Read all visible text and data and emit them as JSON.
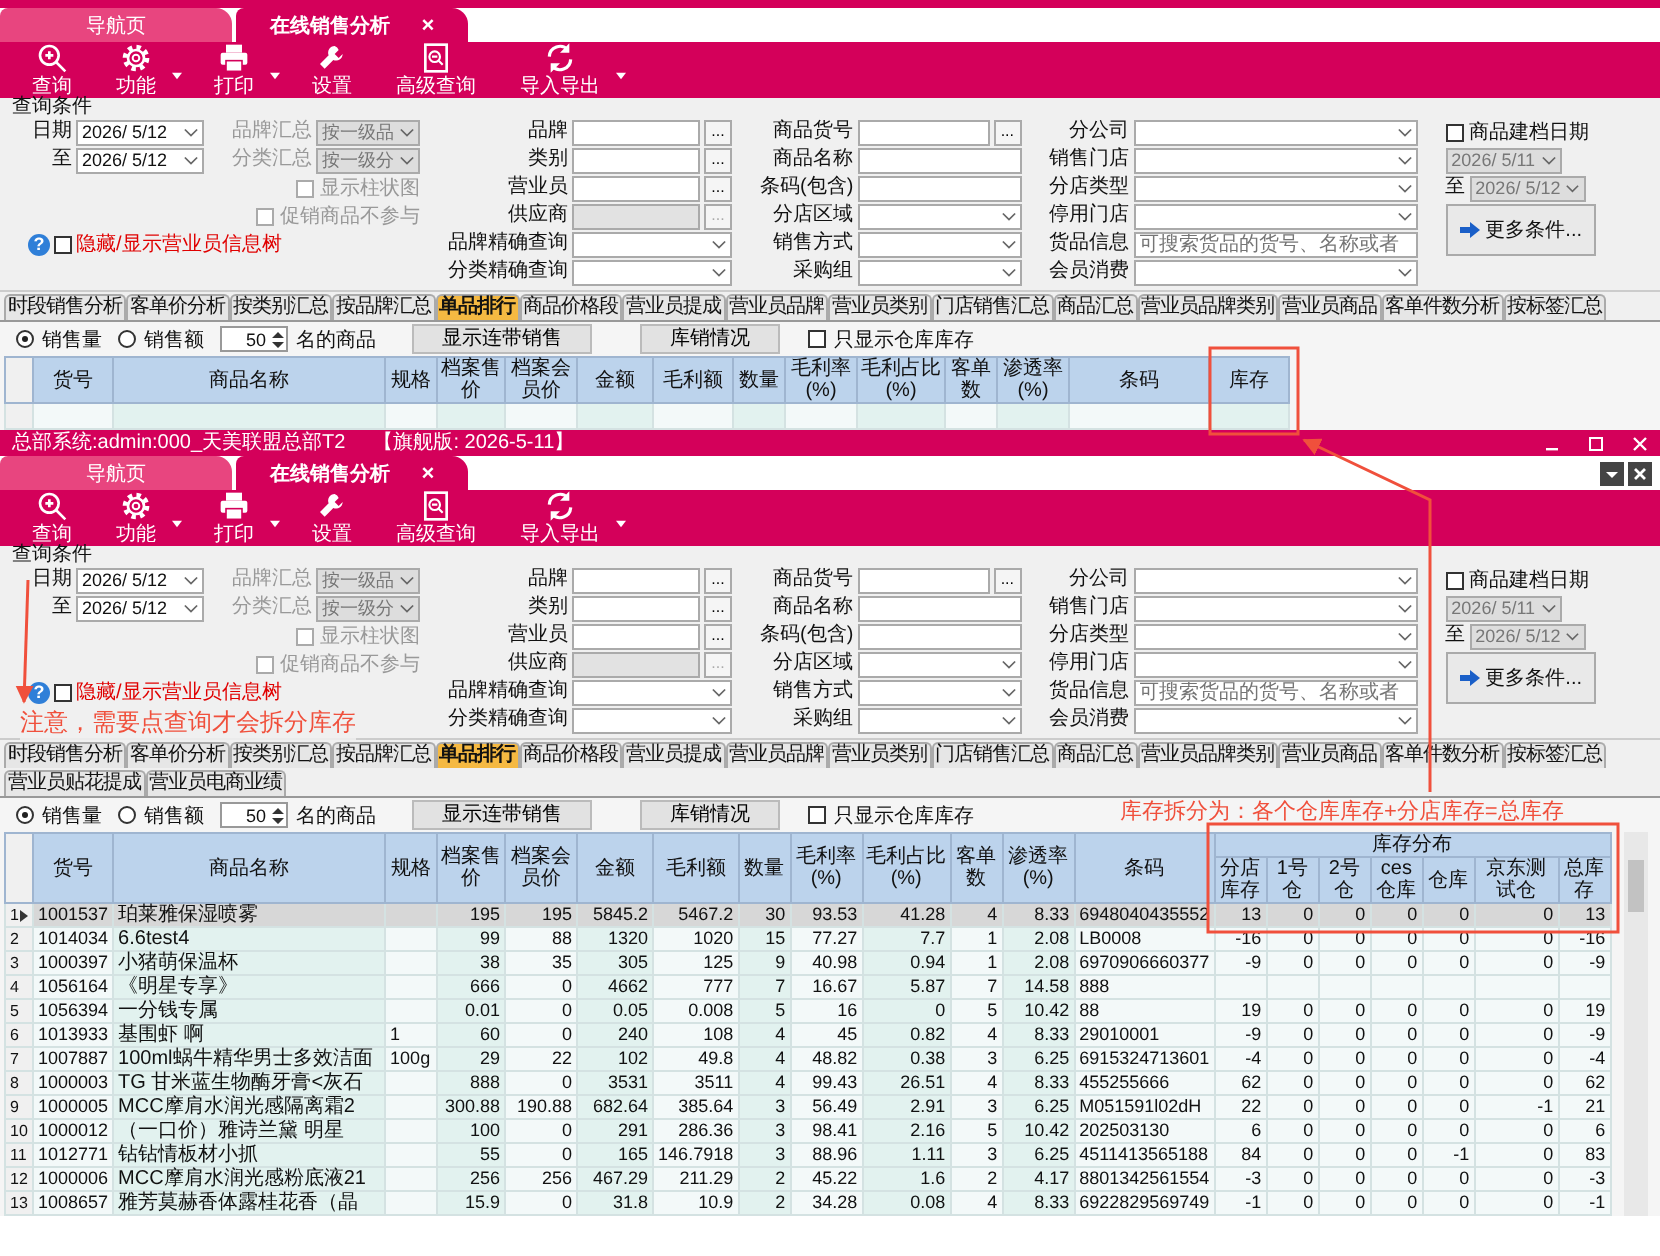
{
  "windows": [
    {
      "doc_tabs": [
        {
          "label": "导航页",
          "selected": false
        },
        {
          "label": "在线销售分析",
          "selected": true,
          "close": "×"
        }
      ],
      "toolbar": [
        {
          "label": "查询",
          "kind": "search",
          "dropdown": false
        },
        {
          "label": "功能",
          "kind": "gear",
          "dropdown": true
        },
        {
          "label": "打印",
          "kind": "printer",
          "dropdown": true
        },
        {
          "label": "设置",
          "kind": "wrench",
          "dropdown": false
        },
        {
          "label": "高级查询",
          "kind": "report",
          "dropdown": false
        },
        {
          "label": "导入导出",
          "kind": "sync",
          "dropdown": true
        }
      ],
      "query": {
        "title": "查询条件",
        "columns": [
          [
            {
              "kind": "date",
              "label": "日期",
              "value": "2026/ 5/12",
              "disabled": false
            },
            {
              "kind": "date",
              "label": "至",
              "value": "2026/ 5/12",
              "disabled": false
            },
            {
              "kind": "toggle",
              "help": "?",
              "label": "隐藏/显示营业员信息树",
              "checked": false,
              "disabled": false
            }
          ],
          [
            {
              "kind": "combo",
              "label": "品牌汇总",
              "value": "按一级品",
              "disabled": true
            },
            {
              "kind": "combo",
              "label": "分类汇总",
              "value": "按一级分",
              "disabled": true
            },
            {
              "kind": "check",
              "label": "显示柱状图",
              "checked": false,
              "disabled": true
            },
            {
              "kind": "check",
              "label": "促销商品不参与",
              "checked": false,
              "disabled": true
            }
          ],
          [
            {
              "kind": "lookup",
              "label": "品牌",
              "button": "...",
              "disabled": false
            },
            {
              "kind": "lookup",
              "label": "类别",
              "button": "...",
              "disabled": false
            },
            {
              "kind": "lookup",
              "label": "营业员",
              "button": "...",
              "disabled": false
            },
            {
              "kind": "lookup",
              "label": "供应商",
              "button": "...",
              "disabled": true
            },
            {
              "kind": "combo",
              "label": "品牌精确查询",
              "disabled": false
            },
            {
              "kind": "combo",
              "label": "分类精确查询",
              "disabled": false
            }
          ],
          [
            {
              "kind": "lookup",
              "label": "商品货号",
              "button": "...",
              "disabled": false
            },
            {
              "kind": "text",
              "label": "商品名称",
              "disabled": false
            },
            {
              "kind": "text",
              "label": "条码(包含)",
              "disabled": false
            },
            {
              "kind": "combo",
              "label": "分店区域",
              "disabled": false
            },
            {
              "kind": "combo",
              "label": "销售方式",
              "disabled": false
            },
            {
              "kind": "combo",
              "label": "采购组",
              "disabled": false
            }
          ],
          [
            {
              "kind": "combo",
              "label": "分公司",
              "disabled": false
            },
            {
              "kind": "combo",
              "label": "销售门店",
              "disabled": false
            },
            {
              "kind": "combo",
              "label": "分店类型",
              "disabled": false
            },
            {
              "kind": "combo",
              "label": "停用门店",
              "disabled": false
            },
            {
              "kind": "text",
              "label": "货品信息",
              "placeholder": "可搜索货品的货号、名称或者",
              "disabled": false
            },
            {
              "kind": "combo",
              "label": "会员消费",
              "disabled": false
            }
          ],
          [
            {
              "kind": "check",
              "label": "商品建档日期",
              "checked": false,
              "disabled": false
            },
            {
              "kind": "date",
              "value": "2026/ 5/11",
              "disabled": true
            },
            {
              "kind": "date",
              "label": "至",
              "value": "2026/ 5/12",
              "disabled": true
            },
            {
              "kind": "button",
              "label": "更多条件...",
              "disabled": false
            }
          ]
        ]
      },
      "report_tabs": [
        {
          "label": "时段销售分析",
          "selected": false
        },
        {
          "label": "客单价分析",
          "selected": false
        },
        {
          "label": "按类别汇总",
          "selected": false
        },
        {
          "label": "按品牌汇总",
          "selected": false
        },
        {
          "label": "单品排行",
          "selected": true
        },
        {
          "label": "商品价格段",
          "selected": false
        },
        {
          "label": "营业员提成",
          "selected": false
        },
        {
          "label": "营业员品牌",
          "selected": false
        },
        {
          "label": "营业员类别",
          "selected": false
        },
        {
          "label": "门店销售汇总",
          "selected": false
        },
        {
          "label": "商品汇总",
          "selected": false
        },
        {
          "label": "营业员品牌类别",
          "selected": false
        },
        {
          "label": "营业员商品",
          "selected": false
        },
        {
          "label": "客单件数分析",
          "selected": false
        },
        {
          "label": "按标签汇总",
          "selected": false
        }
      ],
      "options": {
        "sort": [
          {
            "label": "销售量",
            "selected": true
          },
          {
            "label": "销售额",
            "selected": false
          }
        ],
        "top_n": "50",
        "suffix": "名的商品",
        "buttons": [
          "显示连带销售",
          "库销情况"
        ],
        "only_warehouse": {
          "label": "只显示仓库库存",
          "checked": false
        }
      },
      "table": {
        "columns": [
          "货号",
          "商品名称",
          "规格",
          "档案售价",
          "档案会员价",
          "金额",
          "毛利额",
          "数量",
          "毛利率(%)",
          "毛利占比(%)",
          "客单数",
          "渗透率(%)",
          "条码",
          "库存"
        ]
      }
    },
    {
      "title_bar": {
        "title": "总部系统:admin:000_天美联盟总部T2",
        "edition": "【旗舰版: 2026-5-11】"
      },
      "strip_buttons": true,
      "doc_tabs": [
        {
          "label": "导航页",
          "selected": false
        },
        {
          "label": "在线销售分析",
          "selected": true,
          "close": "×"
        }
      ],
      "toolbar": [
        {
          "label": "查询",
          "kind": "search",
          "dropdown": false
        },
        {
          "label": "功能",
          "kind": "gear",
          "dropdown": true
        },
        {
          "label": "打印",
          "kind": "printer",
          "dropdown": true
        },
        {
          "label": "设置",
          "kind": "wrench",
          "dropdown": false
        },
        {
          "label": "高级查询",
          "kind": "report",
          "dropdown": false
        },
        {
          "label": "导入导出",
          "kind": "sync",
          "dropdown": true
        }
      ],
      "query": {
        "title": "查询条件",
        "columns": [
          [
            {
              "kind": "date",
              "label": "日期",
              "value": "2026/ 5/12",
              "disabled": false
            },
            {
              "kind": "date",
              "label": "至",
              "value": "2026/ 5/12",
              "disabled": false
            },
            {
              "kind": "toggle",
              "help": "?",
              "label": "隐藏/显示营业员信息树",
              "checked": false,
              "disabled": false
            }
          ],
          [
            {
              "kind": "combo",
              "label": "品牌汇总",
              "value": "按一级品",
              "disabled": true
            },
            {
              "kind": "combo",
              "label": "分类汇总",
              "value": "按一级分",
              "disabled": true
            },
            {
              "kind": "check",
              "label": "显示柱状图",
              "checked": false,
              "disabled": true
            },
            {
              "kind": "check",
              "label": "促销商品不参与",
              "checked": false,
              "disabled": true
            }
          ],
          [
            {
              "kind": "lookup",
              "label": "品牌",
              "button": "...",
              "disabled": false
            },
            {
              "kind": "lookup",
              "label": "类别",
              "button": "...",
              "disabled": false
            },
            {
              "kind": "lookup",
              "label": "营业员",
              "button": "...",
              "disabled": false
            },
            {
              "kind": "lookup",
              "label": "供应商",
              "button": "...",
              "disabled": true
            },
            {
              "kind": "combo",
              "label": "品牌精确查询",
              "disabled": false
            },
            {
              "kind": "combo",
              "label": "分类精确查询",
              "disabled": false
            }
          ],
          [
            {
              "kind": "lookup",
              "label": "商品货号",
              "button": "...",
              "disabled": false
            },
            {
              "kind": "text",
              "label": "商品名称",
              "disabled": false
            },
            {
              "kind": "text",
              "label": "条码(包含)",
              "disabled": false
            },
            {
              "kind": "combo",
              "label": "分店区域",
              "disabled": false
            },
            {
              "kind": "combo",
              "label": "销售方式",
              "disabled": false
            },
            {
              "kind": "combo",
              "label": "采购组",
              "disabled": false
            }
          ],
          [
            {
              "kind": "combo",
              "label": "分公司",
              "disabled": false
            },
            {
              "kind": "combo",
              "label": "销售门店",
              "disabled": false
            },
            {
              "kind": "combo",
              "label": "分店类型",
              "disabled": false
            },
            {
              "kind": "combo",
              "label": "停用门店",
              "disabled": false
            },
            {
              "kind": "text",
              "label": "货品信息",
              "placeholder": "可搜索货品的货号、名称或者",
              "disabled": false
            },
            {
              "kind": "combo",
              "label": "会员消费",
              "disabled": false
            }
          ],
          [
            {
              "kind": "check",
              "label": "商品建档日期",
              "checked": false,
              "disabled": false
            },
            {
              "kind": "date",
              "value": "2026/ 5/11",
              "disabled": true
            },
            {
              "kind": "date",
              "label": "至",
              "value": "2026/ 5/12",
              "disabled": true
            },
            {
              "kind": "button",
              "label": "更多条件...",
              "disabled": false
            }
          ]
        ]
      },
      "report_tabs": [
        {
          "label": "时段销售分析",
          "selected": false
        },
        {
          "label": "客单价分析",
          "selected": false
        },
        {
          "label": "按类别汇总",
          "selected": false
        },
        {
          "label": "按品牌汇总",
          "selected": false
        },
        {
          "label": "单品排行",
          "selected": true
        },
        {
          "label": "商品价格段",
          "selected": false
        },
        {
          "label": "营业员提成",
          "selected": false
        },
        {
          "label": "营业员品牌",
          "selected": false
        },
        {
          "label": "营业员类别",
          "selected": false
        },
        {
          "label": "门店销售汇总",
          "selected": false
        },
        {
          "label": "商品汇总",
          "selected": false
        },
        {
          "label": "营业员品牌类别",
          "selected": false
        },
        {
          "label": "营业员商品",
          "selected": false
        },
        {
          "label": "客单件数分析",
          "selected": false
        },
        {
          "label": "按标签汇总",
          "selected": false
        },
        {
          "label": "营业员贴花提成",
          "selected": false
        },
        {
          "label": "营业员电商业绩",
          "selected": false
        }
      ],
      "options": {
        "sort": [
          {
            "label": "销售量",
            "selected": true
          },
          {
            "label": "销售额",
            "selected": false
          }
        ],
        "top_n": "50",
        "suffix": "名的商品",
        "buttons": [
          "显示连带销售",
          "库销情况"
        ],
        "only_warehouse": {
          "label": "只显示仓库库存",
          "checked": false
        }
      },
      "table": {
        "columns": [
          "货号",
          "商品名称",
          "规格",
          "档案售价",
          "档案会员价",
          "金额",
          "毛利额",
          "数量",
          "毛利率(%)",
          "毛利占比(%)",
          "客单数",
          "渗透率(%)",
          "条码"
        ],
        "group": {
          "label": "库存分布",
          "columns": [
            "分店库存",
            "1号仓",
            "2号仓",
            "ces仓库",
            "仓库",
            "京东测试仓",
            "总库存"
          ]
        },
        "rows": [
          {
            "number": "1",
            "selected": true,
            "code": "1001537",
            "name": "珀莱雅保湿喷雾",
            "values": [
              "195",
              "195",
              "5845.2",
              "5467.2",
              "30",
              "93.53",
              "41.28",
              "4",
              "8.33"
            ],
            "barcode": "6948040435552",
            "stock": [
              "13",
              "0",
              "0",
              "0",
              "0",
              "0",
              "13"
            ]
          },
          {
            "number": "2",
            "selected": false,
            "code": "1014034",
            "name": "6.6test4",
            "values": [
              "99",
              "88",
              "1320",
              "1020",
              "15",
              "77.27",
              "7.7",
              "1",
              "2.08"
            ],
            "barcode": "LB0008",
            "stock": [
              "-16",
              "0",
              "0",
              "0",
              "0",
              "0",
              "-16"
            ]
          },
          {
            "number": "3",
            "selected": false,
            "code": "1000397",
            "name": "小猪萌保温杯",
            "values": [
              "38",
              "35",
              "305",
              "125",
              "9",
              "40.98",
              "0.94",
              "1",
              "2.08"
            ],
            "barcode": "6970906660377",
            "stock": [
              "-9",
              "0",
              "0",
              "0",
              "0",
              "0",
              "-9"
            ]
          },
          {
            "number": "4",
            "selected": false,
            "code": "1056164",
            "name": "《明星专享》",
            "values": [
              "666",
              "0",
              "4662",
              "777",
              "7",
              "16.67",
              "5.87",
              "7",
              "14.58"
            ],
            "barcode": "888"
          },
          {
            "number": "5",
            "selected": false,
            "code": "1056394",
            "name": "一分钱专属",
            "values": [
              "0.01",
              "0",
              "0.05",
              "0.008",
              "5",
              "16",
              "0",
              "5",
              "10.42"
            ],
            "barcode": "88",
            "stock": [
              "19",
              "0",
              "0",
              "0",
              "0",
              "0",
              "19"
            ]
          },
          {
            "number": "6",
            "selected": false,
            "code": "1013933",
            "name": "基围虾 啊",
            "spec": "1",
            "values": [
              "60",
              "0",
              "240",
              "108",
              "4",
              "45",
              "0.82",
              "4",
              "8.33"
            ],
            "barcode": "29010001",
            "stock": [
              "-9",
              "0",
              "0",
              "0",
              "0",
              "0",
              "-9"
            ]
          },
          {
            "number": "7",
            "selected": false,
            "code": "1007887",
            "name": "100ml蜗牛精华男士多效洁面",
            "spec": "100g",
            "values": [
              "29",
              "22",
              "102",
              "49.8",
              "4",
              "48.82",
              "0.38",
              "3",
              "6.25"
            ],
            "barcode": "6915324713601",
            "stock": [
              "-4",
              "0",
              "0",
              "0",
              "0",
              "0",
              "-4"
            ]
          },
          {
            "number": "8",
            "selected": false,
            "code": "1000003",
            "name": "TG 甘米蓝生物酶牙膏<灰石",
            "values": [
              "888",
              "0",
              "3531",
              "3511",
              "4",
              "99.43",
              "26.51",
              "4",
              "8.33"
            ],
            "barcode": "455255666",
            "stock": [
              "62",
              "0",
              "0",
              "0",
              "0",
              "0",
              "62"
            ]
          },
          {
            "number": "9",
            "selected": false,
            "code": "1000005",
            "name": "MCC摩肩水润光感隔离霜2",
            "values": [
              "300.88",
              "190.88",
              "682.64",
              "385.64",
              "3",
              "56.49",
              "2.91",
              "3",
              "6.25"
            ],
            "barcode": "M051591l02dH",
            "stock": [
              "22",
              "0",
              "0",
              "0",
              "0",
              "-1",
              "21"
            ]
          },
          {
            "number": "10",
            "selected": false,
            "code": "1000012",
            "name": "（一口价）雅诗兰黛 明星",
            "values": [
              "100",
              "0",
              "291",
              "286.36",
              "3",
              "98.41",
              "2.16",
              "5",
              "10.42"
            ],
            "barcode": "202503130",
            "stock": [
              "6",
              "0",
              "0",
              "0",
              "0",
              "0",
              "6"
            ]
          },
          {
            "number": "11",
            "selected": false,
            "code": "1012771",
            "name": "钻钻情板材小抓",
            "values": [
              "55",
              "0",
              "165",
              "146.7918",
              "3",
              "88.96",
              "1.11",
              "3",
              "6.25"
            ],
            "barcode": "4511413565188",
            "stock": [
              "84",
              "0",
              "0",
              "0",
              "-1",
              "0",
              "83"
            ]
          },
          {
            "number": "12",
            "selected": false,
            "code": "1000006",
            "name": "MCC摩肩水润光感粉底液21",
            "values": [
              "256",
              "256",
              "467.29",
              "211.29",
              "2",
              "45.22",
              "1.6",
              "2",
              "4.17"
            ],
            "barcode": "8801342561554",
            "stock": [
              "-3",
              "0",
              "0",
              "0",
              "0",
              "0",
              "-3"
            ]
          },
          {
            "number": "13",
            "selected": false,
            "code": "1008657",
            "name": "雅芳莫赫香体露桂花香（晶",
            "values": [
              "15.9",
              "0",
              "31.8",
              "10.9",
              "2",
              "34.28",
              "0.08",
              "4",
              "8.33"
            ],
            "barcode": "6922829569749",
            "stock": [
              "-1",
              "0",
              "0",
              "0",
              "0",
              "0",
              "-1"
            ]
          }
        ]
      }
    }
  ],
  "annotations": [
    {
      "text": "库存拆分为：各个仓库库存+分店库存=总库存"
    },
    {
      "text": "注意，需要点查询才会拆分库存"
    }
  ]
}
